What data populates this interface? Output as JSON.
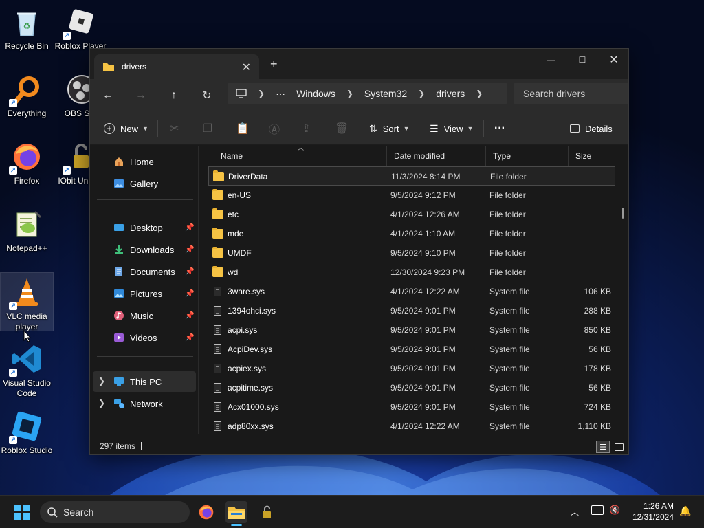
{
  "desktop": {
    "icons": [
      {
        "label": "Recycle Bin"
      },
      {
        "label": "Roblox Player"
      },
      {
        "label": "Everything"
      },
      {
        "label": "OBS Stu"
      },
      {
        "label": "Firefox"
      },
      {
        "label": "IObit Unlock"
      },
      {
        "label": "Notepad++"
      },
      {
        "label": "VLC media player"
      },
      {
        "label": "Visual Studio Code"
      },
      {
        "label": "Roblox Studio"
      }
    ]
  },
  "explorer": {
    "tab_title": "drivers",
    "tab_close": "✕",
    "new_tab": "+",
    "window_controls": {
      "minimize": "—",
      "maximize": "☐",
      "close": "✕"
    },
    "nav": {
      "back": "←",
      "forward": "→",
      "up": "↑",
      "refresh": "↻"
    },
    "breadcrumb": [
      "Windows",
      "System32",
      "drivers"
    ],
    "breadcrumb_more": "···",
    "search_placeholder": "Search drivers",
    "commands": {
      "new": "New",
      "sort": "Sort",
      "view": "View",
      "more": "···",
      "details": "Details"
    },
    "navpane": {
      "home": "Home",
      "gallery": "Gallery",
      "quick": [
        "Desktop",
        "Downloads",
        "Documents",
        "Pictures",
        "Music",
        "Videos"
      ],
      "this_pc": "This PC",
      "network": "Network"
    },
    "columns": {
      "name": "Name",
      "date": "Date modified",
      "type": "Type",
      "size": "Size"
    },
    "rows": [
      {
        "name": "DriverData",
        "date": "11/3/2024 8:14 PM",
        "type": "File folder",
        "size": "",
        "kind": "folder"
      },
      {
        "name": "en-US",
        "date": "9/5/2024 9:12 PM",
        "type": "File folder",
        "size": "",
        "kind": "folder"
      },
      {
        "name": "etc",
        "date": "4/1/2024 12:26 AM",
        "type": "File folder",
        "size": "",
        "kind": "folder"
      },
      {
        "name": "mde",
        "date": "4/1/2024 1:10 AM",
        "type": "File folder",
        "size": "",
        "kind": "folder"
      },
      {
        "name": "UMDF",
        "date": "9/5/2024 9:10 PM",
        "type": "File folder",
        "size": "",
        "kind": "folder"
      },
      {
        "name": "wd",
        "date": "12/30/2024 9:23 PM",
        "type": "File folder",
        "size": "",
        "kind": "folder"
      },
      {
        "name": "3ware.sys",
        "date": "4/1/2024 12:22 AM",
        "type": "System file",
        "size": "106 KB",
        "kind": "file"
      },
      {
        "name": "1394ohci.sys",
        "date": "9/5/2024 9:01 PM",
        "type": "System file",
        "size": "288 KB",
        "kind": "file"
      },
      {
        "name": "acpi.sys",
        "date": "9/5/2024 9:01 PM",
        "type": "System file",
        "size": "850 KB",
        "kind": "file"
      },
      {
        "name": "AcpiDev.sys",
        "date": "9/5/2024 9:01 PM",
        "type": "System file",
        "size": "56 KB",
        "kind": "file"
      },
      {
        "name": "acpiex.sys",
        "date": "9/5/2024 9:01 PM",
        "type": "System file",
        "size": "178 KB",
        "kind": "file"
      },
      {
        "name": "acpitime.sys",
        "date": "9/5/2024 9:01 PM",
        "type": "System file",
        "size": "56 KB",
        "kind": "file"
      },
      {
        "name": "Acx01000.sys",
        "date": "9/5/2024 9:01 PM",
        "type": "System file",
        "size": "724 KB",
        "kind": "file"
      },
      {
        "name": "adp80xx.sys",
        "date": "4/1/2024 12:22 AM",
        "type": "System file",
        "size": "1,110 KB",
        "kind": "file"
      }
    ],
    "status": "297 items"
  },
  "taskbar": {
    "search_placeholder": "Search",
    "time": "1:26 AM",
    "date": "12/31/2024"
  }
}
